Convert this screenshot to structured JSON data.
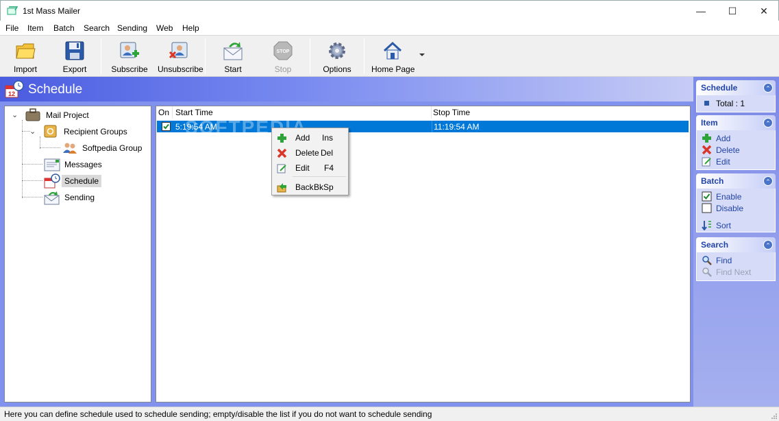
{
  "window": {
    "title": "1st Mass Mailer",
    "minimize_glyph": "—",
    "maximize_glyph": "☐",
    "close_glyph": "✕"
  },
  "menu": [
    "File",
    "Item",
    "Batch",
    "Search",
    "Sending",
    "Web",
    "Help"
  ],
  "toolbar": {
    "import": "Import",
    "export": "Export",
    "subscribe": "Subscribe",
    "unsubscribe": "Unsubscribe",
    "start": "Start",
    "stop": "Stop",
    "options": "Options",
    "home_page": "Home Page",
    "stop_icon_text": "STOP"
  },
  "header": {
    "title": "Schedule",
    "calendar_day": "12"
  },
  "tree": {
    "root": "Mail Project",
    "recipient_groups": "Recipient Groups",
    "softpedia_group": "Softpedia Group",
    "messages": "Messages",
    "schedule": "Schedule",
    "sending": "Sending"
  },
  "list": {
    "col_on": "On",
    "col_start": "Start Time",
    "col_stop": "Stop Time",
    "rows": [
      {
        "on": true,
        "start": "5:19:54 AM",
        "stop": "11:19:54 AM"
      }
    ],
    "watermark": "SOFTPEDIA"
  },
  "context_menu": {
    "add": "Add",
    "add_key": "Ins",
    "delete": "Delete",
    "delete_key": "Del",
    "edit": "Edit",
    "edit_key": "F4",
    "back": "Back",
    "back_key": "BkSp"
  },
  "task_pane": {
    "schedule": {
      "title": "Schedule",
      "total": "Total : 1"
    },
    "item": {
      "title": "Item",
      "add": "Add",
      "delete": "Delete",
      "edit": "Edit"
    },
    "batch": {
      "title": "Batch",
      "enable": "Enable",
      "disable": "Disable",
      "sort": "Sort"
    },
    "search": {
      "title": "Search",
      "find": "Find",
      "find_next": "Find Next"
    },
    "collapse_glyph": "⌃"
  },
  "status": "Here you can define schedule used to schedule sending; empty/disable the list if you do not want to schedule sending",
  "colors": {
    "selection": "#0078d7",
    "header_gradient_start": "#4a5ce0",
    "task_title": "#2143a6"
  }
}
